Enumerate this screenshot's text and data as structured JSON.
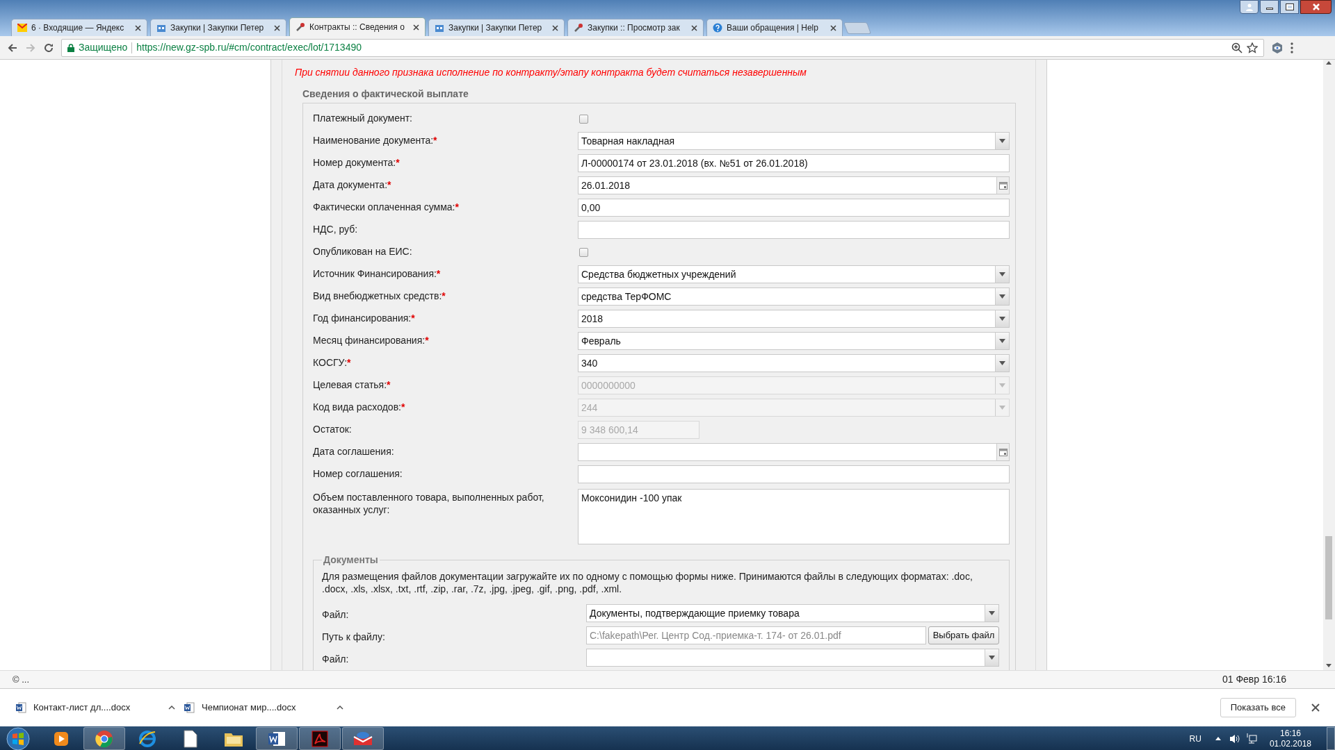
{
  "tabs": [
    {
      "label": "6 · Входящие — Яндекс",
      "selected": false
    },
    {
      "label": "Закупки | Закупки Петер",
      "selected": false
    },
    {
      "label": "Контракты :: Сведения о",
      "selected": true
    },
    {
      "label": "Закупки | Закупки Петер",
      "selected": false
    },
    {
      "label": "Закупки :: Просмотр зак",
      "selected": false
    },
    {
      "label": "Ваши обращения | Help",
      "selected": false
    }
  ],
  "address_bar": {
    "security": "Защищено",
    "url": "https://new.gz-spb.ru/#cm/contract/exec/lot/1713490"
  },
  "notice": "При снятии данного признака исполнение по контракту/этапу контракта будет считаться незавершенным",
  "payment_section": {
    "legend": "Сведения о фактической выплате",
    "fields": [
      {
        "label": "Платежный документ:",
        "kind": "checkbox",
        "checked": false,
        "disabled": false
      },
      {
        "label": "Наименование документа:",
        "mark": "*",
        "kind": "combo",
        "value": "Товарная накладная",
        "disabled": false
      },
      {
        "label": "Номер документа:",
        "mark": "*",
        "kind": "text",
        "value": "Л-00000174 от 23.01.2018 (вх. №51 от 26.01.2018)",
        "disabled": false
      },
      {
        "label": "Дата документа:",
        "mark": "*",
        "kind": "date",
        "value": "26.01.2018",
        "disabled": false
      },
      {
        "label": "Фактически оплаченная сумма:",
        "mark": "*",
        "kind": "text",
        "value": "0,00",
        "disabled": false
      },
      {
        "label": "НДС, руб:",
        "kind": "text",
        "disabled": false
      },
      {
        "label": "Опубликован на ЕИС:",
        "kind": "checkbox",
        "checked": false,
        "disabled": false
      },
      {
        "label": "Источник Финансирования:",
        "mark": "*",
        "kind": "combo",
        "value": "Средства бюджетных учреждений",
        "disabled": false
      },
      {
        "label": "Вид внебюджетных средств:",
        "mark": "*",
        "kind": "combo",
        "value": "средства ТерФОМС",
        "disabled": false
      },
      {
        "label": "Год финансирования:",
        "mark": "*",
        "kind": "combo",
        "value": "2018",
        "disabled": false
      },
      {
        "label": "Месяц финансирования:",
        "mark": "*",
        "kind": "combo",
        "value": "Февраль",
        "disabled": false
      },
      {
        "label": "КОСГУ:",
        "mark": "*",
        "kind": "combo",
        "value": "340",
        "disabled": false
      },
      {
        "label": "Целевая статья:",
        "mark": "*",
        "kind": "combo",
        "value": "0000000000",
        "disabled": true
      },
      {
        "label": "Код вида расходов:",
        "mark": "*",
        "kind": "combo",
        "value": "244",
        "disabled": true
      },
      {
        "label": "Остаток:",
        "kind": "short",
        "value": "9 348 600,14",
        "disabled": true
      },
      {
        "label": "Дата соглашения:",
        "kind": "date",
        "disabled": false
      },
      {
        "label": "Номер соглашения:",
        "kind": "text",
        "disabled": false
      },
      {
        "label": "Объем поставленного товара, выполненных работ, оказанных услуг:",
        "kind": "textarea",
        "value": "Моксонидин -100 упак",
        "disabled": false
      }
    ]
  },
  "documents": {
    "legend": "Документы",
    "description": "Для размещения файлов документации загружайте их по одному с помощью формы ниже. Принимаются файлы в следующих форматах: .doc, .docx, .xls, .xlsx, .txt, .rtf, .zip, .rar, .7z, .jpg, .jpeg, .gif, .png, .pdf, .xml.",
    "fields": [
      {
        "label": "Файл:",
        "kind": "combo",
        "value": "Документы, подтверждающие приемку товара"
      },
      {
        "label": "Путь к файлу:",
        "kind": "file",
        "value": "C:\\fakepath\\Рег. Центр Сод.-приемка-т. 174- от 26.01.pdf",
        "button": "Выбрать файл"
      },
      {
        "label": "Файл:",
        "kind": "combo"
      }
    ]
  },
  "status_bar": {
    "left": "© ...",
    "right": "01 Февр 16:16"
  },
  "downloads": {
    "items": [
      {
        "name": "Контакт-лист дл....docx"
      },
      {
        "name": "Чемпионат мир....docx"
      }
    ],
    "show_all": "Показать все"
  },
  "taskbar": {
    "language": "RU",
    "time": "16:16",
    "date": "01.02.2018"
  }
}
